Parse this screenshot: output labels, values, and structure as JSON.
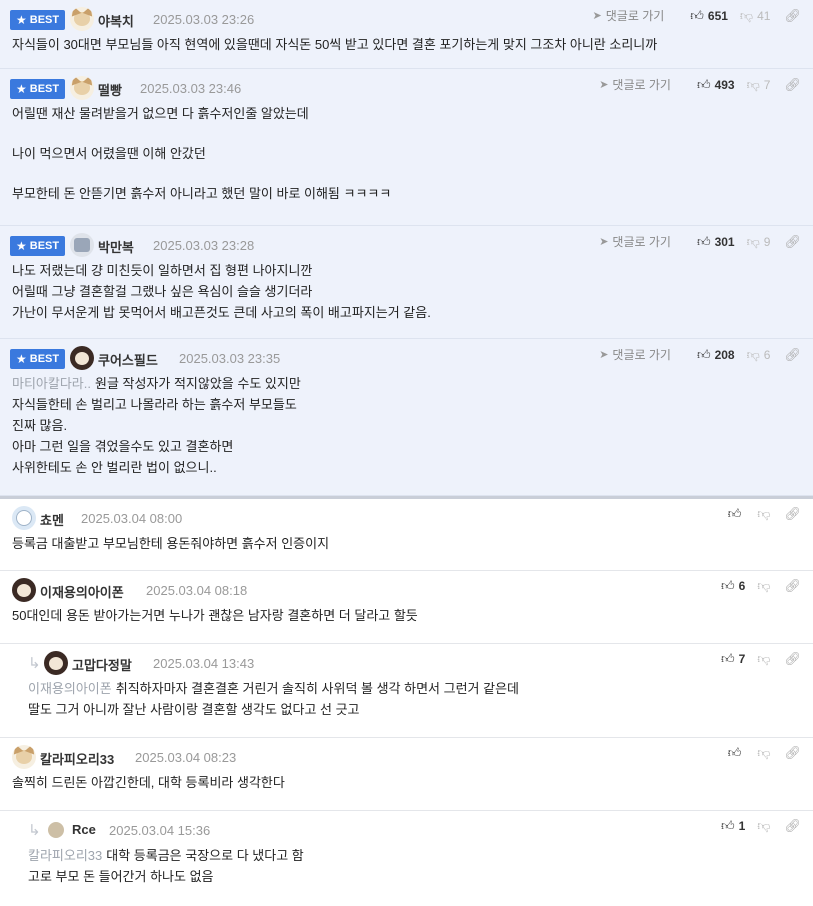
{
  "best_label": "BEST",
  "goto_label": "댓글로 가기",
  "comments": [
    {
      "nick": "야복치",
      "date": "2025.03.03 23:26",
      "likes": "651",
      "dislikes": "41",
      "lines": [
        "자식들이 30대면 부모님들 아직 현역에 있을땐데 자식돈 50씩 받고 있다면 결혼 포기하는게 맞지 그조차 아니란 소리니까"
      ]
    },
    {
      "nick": "떨빵",
      "date": "2025.03.03 23:46",
      "likes": "493",
      "dislikes": "7",
      "lines": [
        "어릴땐 재산 물려받을거 없으면 다 흙수저인줄 알았는데",
        "나이 먹으면서 어렸을땐 이해 안갔던",
        "부모한테 돈 안뜯기면 흙수저 아니라고 했던 말이 바로 이해됨 ㅋㅋㅋㅋ"
      ]
    },
    {
      "nick": "박만복",
      "date": "2025.03.03 23:28",
      "likes": "301",
      "dislikes": "9",
      "lines": [
        "나도 저랬는데 걍 미친듯이 일하면서 집 형편 나아지니깐",
        "어릴때 그냥 결혼할걸 그랬나 싶은 욕심이 슬슬 생기더라",
        "가난이 무서운게 밥 못먹어서 배고픈것도 큰데 사고의 폭이 배고파지는거 같음."
      ]
    },
    {
      "nick": "쿠어스필드",
      "date": "2025.03.03 23:35",
      "likes": "208",
      "dislikes": "6",
      "mention": "마티아칼다라..",
      "lines": [
        "원글 작성자가 적지않았을 수도 있지만",
        "자식들한테 손 벌리고 나몰라라 하는 흙수저 부모들도",
        "진짜 많음.",
        "아마 그런 일을 겪었을수도 있고 결혼하면",
        "사위한테도 손 안 벌리란 법이 없으니.."
      ]
    },
    {
      "nick": "쵸멘",
      "date": "2025.03.04 08:00",
      "likes": "",
      "lines": [
        "등록금 대출받고 부모님한테 용돈줘야하면 흙수저 인증이지"
      ]
    },
    {
      "nick": "이재용의아이폰",
      "date": "2025.03.04 08:18",
      "likes": "6",
      "lines": [
        "50대인데 용돈 받아가는거면 누나가 괜찮은 남자랑 결혼하면 더 달라고 할듯"
      ]
    },
    {
      "nick": "고맙다정말",
      "date": "2025.03.04 13:43",
      "likes": "7",
      "mention": "이재용의아이폰",
      "lines": [
        "취직하자마자 결혼결혼 거린거 솔직히 사위덕 볼 생각 하면서 그런거 같은데",
        "딸도 그거 아니까 잘난 사람이랑 결혼할 생각도 없다고 선 긋고"
      ]
    },
    {
      "nick": "칼라피오리33",
      "date": "2025.03.04 08:23",
      "likes": "",
      "lines": [
        "솔찍히 드린돈 아깝긴한데, 대학 등록비라 생각한다"
      ]
    },
    {
      "nick": "Rce",
      "date": "2025.03.04 15:36",
      "likes": "1",
      "mention": "칼라피오리33",
      "lines": [
        "대학 등록금은 국장으로 다 냈다고 함",
        "고로 부모 돈 들어간거 하나도 없음"
      ]
    }
  ]
}
